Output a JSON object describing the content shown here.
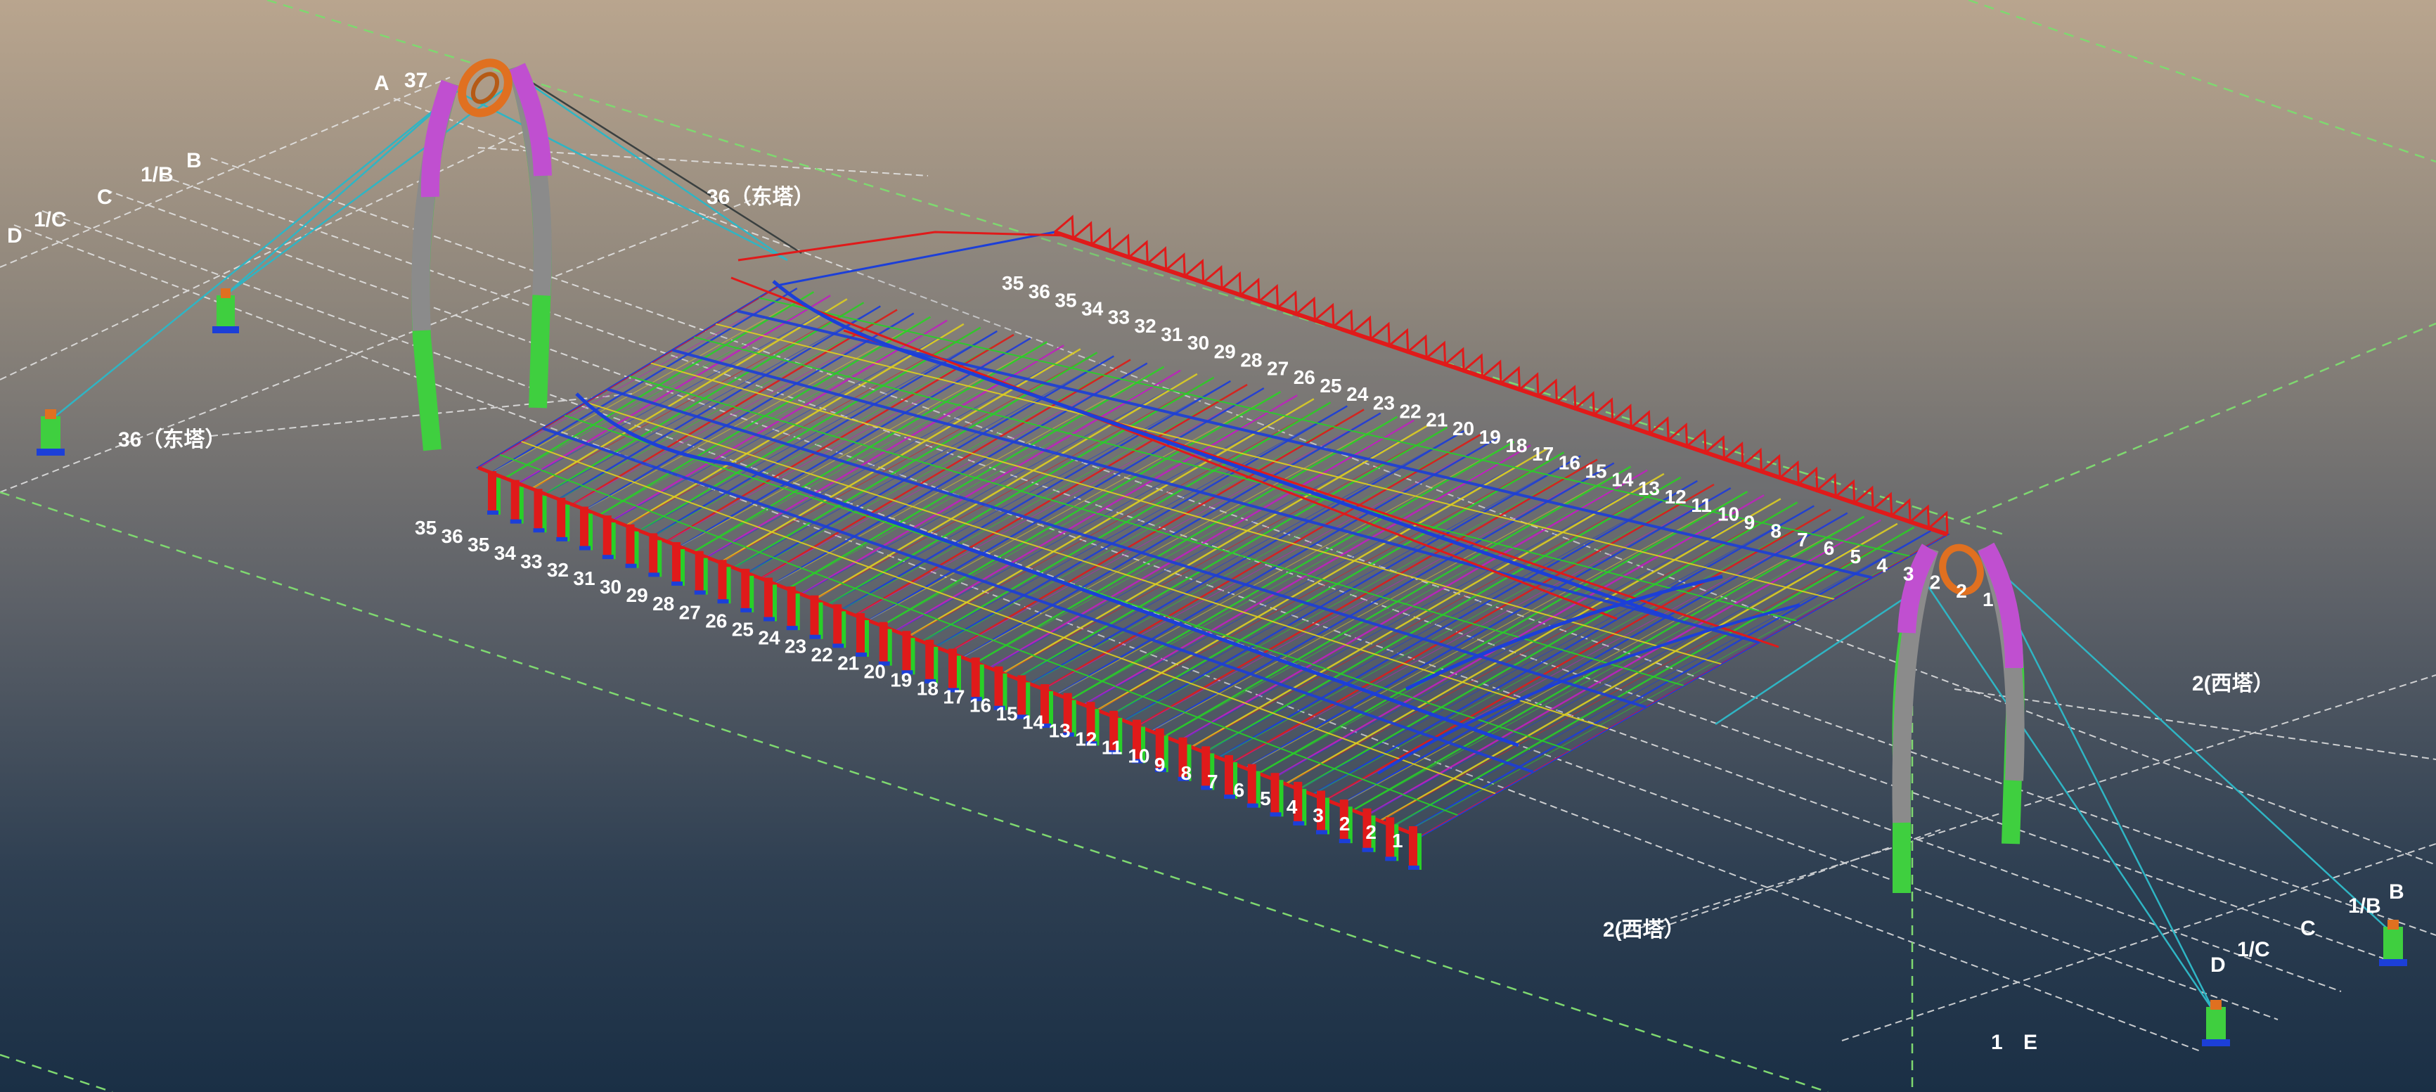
{
  "colors": {
    "sky_top": "#b9a58e",
    "sky_bottom": "#1a2f45",
    "grid_line": "#e6e6e6",
    "guide_line": "#7fd870",
    "cable": "#2fb5c4",
    "arch_purple": "#c04fd0",
    "arch_grey": "#8b8b8b",
    "arch_green": "#3fcf3f",
    "truss_red": "#e01a1a",
    "member_blue": "#1c3fd8",
    "member_green": "#28d028",
    "member_yellow": "#e0d020",
    "member_magenta": "#c020c0",
    "ring_orange": "#e07020",
    "label_white": "#ffffff"
  },
  "labels": {
    "east_axis_top": "36（东塔）",
    "east_axis_left": "36（东塔）",
    "west_axis_right": "2(西塔）",
    "west_axis_bottom": "2(西塔）",
    "axis_37": "37",
    "axis_A": "A",
    "axis_B_left": "B",
    "axis_1B_left": "1/B",
    "axis_C_left": "C",
    "axis_1C_left": "1/C",
    "axis_D_left": "D",
    "axis_B_right": "B",
    "axis_1B_right": "1/B",
    "axis_C_right": "C",
    "axis_1C_right": "1/C",
    "axis_D_right": "D",
    "axis_1": "1",
    "axis_E": "E"
  },
  "grid_front": [
    "35",
    "36",
    "35",
    "34",
    "33",
    "32",
    "31",
    "30",
    "29",
    "28",
    "27",
    "26",
    "25",
    "24",
    "23",
    "22",
    "21",
    "20",
    "19",
    "18",
    "17",
    "16",
    "15",
    "14",
    "13",
    "12",
    "11",
    "10",
    "9",
    "8",
    "7",
    "6",
    "5",
    "4",
    "3",
    "2",
    "2",
    "1"
  ],
  "grid_back": [
    "35",
    "36",
    "35",
    "34",
    "33",
    "32",
    "31",
    "30",
    "29",
    "28",
    "27",
    "26",
    "25",
    "24",
    "23",
    "22",
    "21",
    "20",
    "19",
    "18",
    "17",
    "16",
    "15",
    "14",
    "13",
    "12",
    "11",
    "10",
    "9",
    "8",
    "7",
    "6",
    "5",
    "4",
    "3",
    "2",
    "2",
    "1"
  ]
}
